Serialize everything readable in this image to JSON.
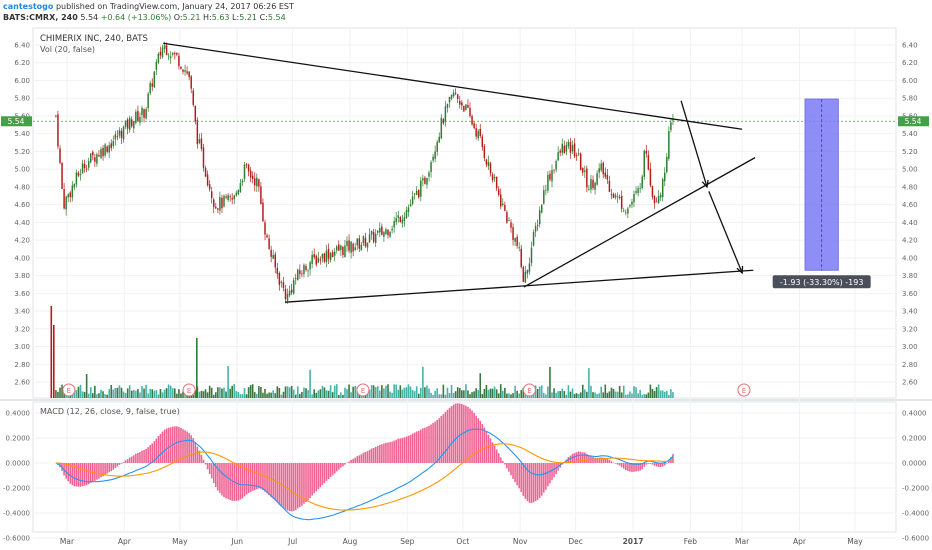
{
  "header": {
    "user": "cantestogo",
    "published": "published on TradingView.com, January 24, 2017 06:26 EST",
    "symbol": "BATS:CMRX, 240",
    "last": "5.54",
    "change": "+0.64 (+13.06%)",
    "o_label": "O:",
    "o_val": "5.21",
    "h_label": "H:",
    "h_val": "5.63",
    "l_label": "L:",
    "l_val": "5.21",
    "c_label": "C:",
    "c_val": "5.54"
  },
  "legend": {
    "main": "CHIMERIX INC, 240, BATS",
    "vol": "Vol (20, false)",
    "macd": "MACD (12, 26, close, 9, false, true)"
  },
  "price_badge": "5.54",
  "measure_label": "-1.93 (-33.30%) -193",
  "earnings_marker": "E",
  "chart_data": [
    {
      "type": "candlestick",
      "title": "CHIMERIX INC, 240, BATS",
      "ylim": [
        3.1,
        6.55
      ],
      "price_ticks": [
        "6.40",
        "6.20",
        "6.00",
        "5.80",
        "5.60",
        "5.40",
        "5.20",
        "5.00",
        "4.80",
        "4.60",
        "4.40",
        "4.20",
        "4.00",
        "3.80",
        "3.60",
        "3.40",
        "3.20",
        "3.00",
        "2.80",
        "2.60"
      ],
      "x_labels": [
        "Mar",
        "Apr",
        "May",
        "Jun",
        "Jul",
        "Aug",
        "Sep",
        "Oct",
        "Nov",
        "Dec",
        "2017",
        "Feb",
        "Mar",
        "Apr",
        "May"
      ],
      "last_price": 5.54,
      "close_path": [
        [
          "2016-02-24",
          5.6
        ],
        [
          "2016-02-28",
          4.6
        ],
        [
          "2016-03-10",
          5.05
        ],
        [
          "2016-03-25",
          5.3
        ],
        [
          "2016-04-05",
          5.55
        ],
        [
          "2016-04-12",
          5.65
        ],
        [
          "2016-04-18",
          6.15
        ],
        [
          "2016-04-22",
          6.4
        ],
        [
          "2016-04-30",
          6.25
        ],
        [
          "2016-05-06",
          6.05
        ],
        [
          "2016-05-10",
          5.4
        ],
        [
          "2016-05-14",
          5.05
        ],
        [
          "2016-05-20",
          4.6
        ],
        [
          "2016-05-30",
          4.65
        ],
        [
          "2016-06-05",
          5.0
        ],
        [
          "2016-06-12",
          4.85
        ],
        [
          "2016-06-17",
          4.2
        ],
        [
          "2016-06-22",
          3.85
        ],
        [
          "2016-06-28",
          3.55
        ],
        [
          "2016-07-02",
          3.75
        ],
        [
          "2016-07-10",
          3.95
        ],
        [
          "2016-07-20",
          4.05
        ],
        [
          "2016-08-05",
          4.15
        ],
        [
          "2016-08-20",
          4.3
        ],
        [
          "2016-09-01",
          4.55
        ],
        [
          "2016-09-10",
          4.85
        ],
        [
          "2016-09-20",
          5.55
        ],
        [
          "2016-09-26",
          5.85
        ],
        [
          "2016-10-02",
          5.7
        ],
        [
          "2016-10-10",
          5.35
        ],
        [
          "2016-10-17",
          4.9
        ],
        [
          "2016-10-24",
          4.5
        ],
        [
          "2016-10-31",
          4.1
        ],
        [
          "2016-11-03",
          3.72
        ],
        [
          "2016-11-08",
          4.2
        ],
        [
          "2016-11-15",
          4.85
        ],
        [
          "2016-11-24",
          5.25
        ],
        [
          "2016-12-01",
          5.2
        ],
        [
          "2016-12-08",
          4.8
        ],
        [
          "2016-12-15",
          5.0
        ],
        [
          "2016-12-22",
          4.7
        ],
        [
          "2016-12-29",
          4.55
        ],
        [
          "2017-01-04",
          4.75
        ],
        [
          "2017-01-08",
          5.25
        ],
        [
          "2017-01-12",
          4.65
        ],
        [
          "2017-01-17",
          4.8
        ],
        [
          "2017-01-20",
          5.35
        ],
        [
          "2017-01-23",
          5.55
        ]
      ],
      "trendlines": [
        {
          "from": [
            "2016-04-22",
            6.42
          ],
          "to": [
            "2017-03-01",
            5.45
          ]
        },
        {
          "from": [
            "2016-06-27",
            3.5
          ],
          "to": [
            "2017-03-07",
            3.86
          ]
        },
        {
          "from": [
            "2016-11-03",
            3.67
          ],
          "to": [
            "2017-03-08",
            5.13
          ]
        }
      ],
      "arrows": [
        {
          "from": [
            "2017-01-27",
            5.77
          ],
          "to": [
            "2017-02-10",
            4.8
          ]
        },
        {
          "from": [
            "2017-02-11",
            4.75
          ],
          "to": [
            "2017-03-01",
            3.83
          ]
        }
      ],
      "measure_box": {
        "x_start": "2017-04-04",
        "x_end": "2017-04-22",
        "y_top": 5.79,
        "y_bottom": 3.86
      },
      "earnings_dates": [
        "2016-03-02",
        "2016-05-06",
        "2016-08-08",
        "2016-11-06",
        "2017-03-02"
      ]
    },
    {
      "type": "bar",
      "title": "Vol (20, false)",
      "colors": {
        "up": "#26a69a",
        "down": "#ef5350"
      }
    },
    {
      "type": "line",
      "title": "MACD (12, 26, close, 9, false, true)",
      "ylim": [
        -0.62,
        0.47
      ],
      "y_ticks": [
        "0.4000",
        "0.2000",
        "0.0000",
        "-0.2000",
        "-0.4000",
        "-0.6000"
      ],
      "series": [
        {
          "colors": {
            "macd": "#2196f3",
            "signal": "#ff9800",
            "histogram": "#f06292"
          }
        }
      ]
    }
  ]
}
